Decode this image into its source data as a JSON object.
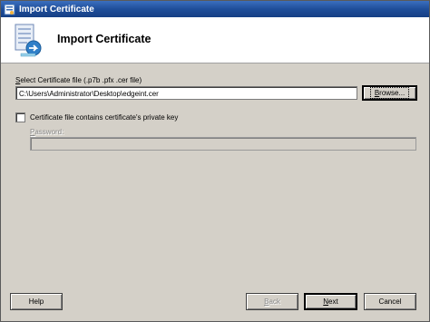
{
  "window": {
    "title": "Import Certificate",
    "header_title": "Import Certificate"
  },
  "form": {
    "file_label_pre": "",
    "file_label_accel": "S",
    "file_label_post": "elect Certificate file (.p7b .pfx .cer file)",
    "file_path": "C:\\Users\\Administrator\\Desktop\\edgeint.cer",
    "browse_pre": "",
    "browse_accel": "B",
    "browse_post": "rowse...",
    "checkbox_label": "Certificate file contains certificate's private key",
    "checkbox_checked": false,
    "password_label_accel": "P",
    "password_label_post": "assword:",
    "password_value": ""
  },
  "footer": {
    "help": "Help",
    "back_accel": "B",
    "back_post": "ack",
    "next_accel": "N",
    "next_post": "ext",
    "cancel": "Cancel"
  },
  "icons": {
    "title_icon": "certificate-app-icon",
    "header_icon": "import-certificate-icon"
  }
}
